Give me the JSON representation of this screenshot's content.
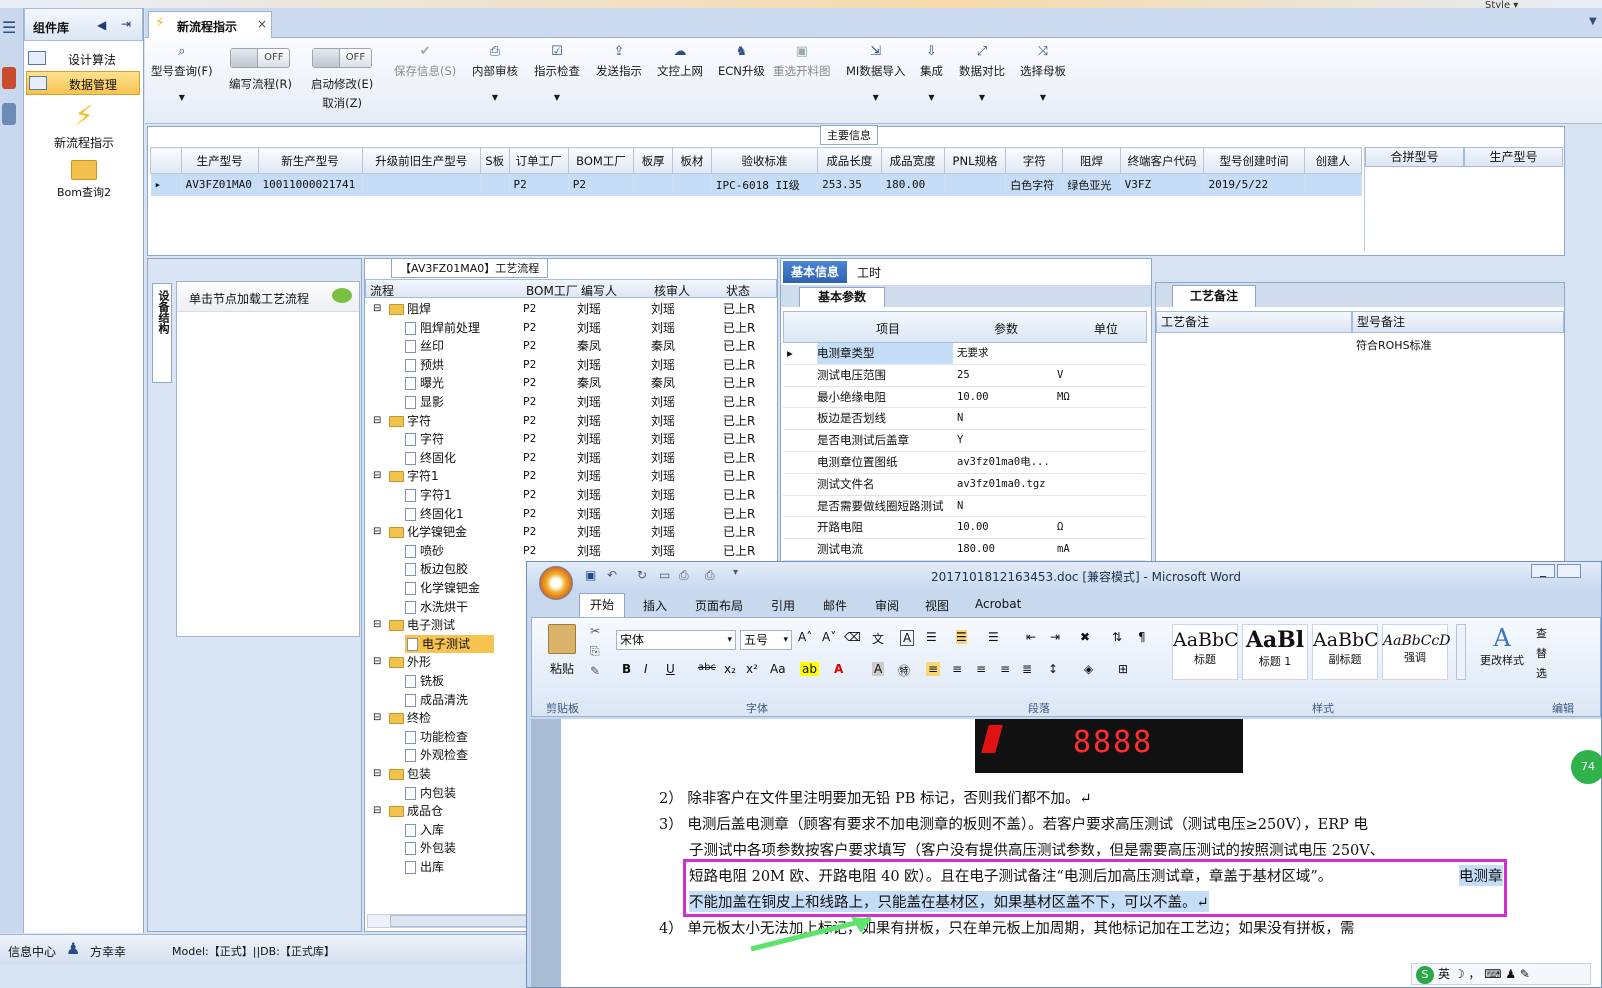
{
  "app": {
    "style_label": "Style",
    "components_label": "组件库"
  },
  "left_nav": {
    "items": [
      "设计算法",
      "数据管理"
    ],
    "big_items": [
      "新流程指示",
      "Bom查询2"
    ]
  },
  "tab": {
    "title": "新流程指示",
    "close": "×"
  },
  "toolbar": {
    "query": "型号查询(F)",
    "edit_toggle": "OFF",
    "edit_label": "编写流程(R)",
    "start_toggle": "OFF",
    "start_label": "启动修改(E)",
    "cancel_label": "取消(Z)",
    "buttons": [
      "保存信息(S)",
      "内部审核",
      "指示检查",
      "发送指示",
      "文控上网",
      "ECN升级",
      "重选开料图",
      "MI数据导入",
      "集成",
      "数据对比",
      "选择母板"
    ]
  },
  "main_info": {
    "title": "主要信息",
    "columns": [
      "生产型号",
      "新生产型号",
      "升级前旧生产型号",
      "S板",
      "订单工厂",
      "BOM工厂",
      "板厚",
      "板材",
      "验收标准",
      "成品长度",
      "成品宽度",
      "PNL规格",
      "字符",
      "阻焊",
      "终端客户代码",
      "型号创建时间",
      "创建人"
    ],
    "row": [
      "AV3FZ01MA0",
      "10011000021741",
      "",
      "",
      "P2",
      "P2",
      "",
      "",
      "IPC-6018 II级",
      "253.35",
      "180.00",
      "",
      "白色字符",
      "绿色亚光",
      "V3FZ",
      "2019/5/22",
      ""
    ],
    "side_columns": [
      "合拼型号",
      "生产型号"
    ]
  },
  "device_panel": {
    "tab": "设备结构",
    "hint": "单击节点加载工艺流程"
  },
  "flow": {
    "title": "【AV3FZ01MA0】工艺流程",
    "columns": [
      "流程",
      "BOM工厂",
      "编写人",
      "核审人",
      "状态"
    ],
    "rows": [
      {
        "level": 0,
        "name": "阻焊",
        "bom": "P2",
        "writer": "刘瑶",
        "checker": "刘瑶",
        "status": "已上R"
      },
      {
        "level": 1,
        "name": "阻焊前处理",
        "bom": "P2",
        "writer": "刘瑶",
        "checker": "刘瑶",
        "status": "已上R"
      },
      {
        "level": 1,
        "name": "丝印",
        "bom": "P2",
        "writer": "秦凤",
        "checker": "秦凤",
        "status": "已上R"
      },
      {
        "level": 1,
        "name": "预烘",
        "bom": "P2",
        "writer": "刘瑶",
        "checker": "刘瑶",
        "status": "已上R"
      },
      {
        "level": 1,
        "name": "曝光",
        "bom": "P2",
        "writer": "秦凤",
        "checker": "秦凤",
        "status": "已上R"
      },
      {
        "level": 1,
        "name": "显影",
        "bom": "P2",
        "writer": "刘瑶",
        "checker": "刘瑶",
        "status": "已上R"
      },
      {
        "level": 0,
        "name": "字符",
        "bom": "P2",
        "writer": "刘瑶",
        "checker": "刘瑶",
        "status": "已上R"
      },
      {
        "level": 1,
        "name": "字符",
        "bom": "P2",
        "writer": "刘瑶",
        "checker": "刘瑶",
        "status": "已上R"
      },
      {
        "level": 1,
        "name": "终固化",
        "bom": "P2",
        "writer": "刘瑶",
        "checker": "刘瑶",
        "status": "已上R"
      },
      {
        "level": 0,
        "name": "字符1",
        "bom": "P2",
        "writer": "刘瑶",
        "checker": "刘瑶",
        "status": "已上R"
      },
      {
        "level": 1,
        "name": "字符1",
        "bom": "P2",
        "writer": "刘瑶",
        "checker": "刘瑶",
        "status": "已上R"
      },
      {
        "level": 1,
        "name": "终固化1",
        "bom": "P2",
        "writer": "刘瑶",
        "checker": "刘瑶",
        "status": "已上R"
      },
      {
        "level": 0,
        "name": "化学镍钯金",
        "bom": "P2",
        "writer": "刘瑶",
        "checker": "刘瑶",
        "status": "已上R"
      },
      {
        "level": 1,
        "name": "喷砂",
        "bom": "P2",
        "writer": "刘瑶",
        "checker": "刘瑶",
        "status": "已上R"
      },
      {
        "level": 1,
        "name": "板边包胶",
        "bom": "",
        "writer": "",
        "checker": "",
        "status": ""
      },
      {
        "level": 1,
        "name": "化学镍钯金",
        "bom": "",
        "writer": "",
        "checker": "",
        "status": ""
      },
      {
        "level": 1,
        "name": "水洗烘干",
        "bom": "",
        "writer": "",
        "checker": "",
        "status": ""
      },
      {
        "level": 0,
        "name": "电子测试",
        "bom": "",
        "writer": "",
        "checker": "",
        "status": ""
      },
      {
        "level": 1,
        "name": "电子测试",
        "bom": "",
        "writer": "",
        "checker": "",
        "status": "",
        "selected": true
      },
      {
        "level": 0,
        "name": "外形",
        "bom": "",
        "writer": "",
        "checker": "",
        "status": ""
      },
      {
        "level": 1,
        "name": "铣板",
        "bom": "",
        "writer": "",
        "checker": "",
        "status": ""
      },
      {
        "level": 1,
        "name": "成品清洗",
        "bom": "",
        "writer": "",
        "checker": "",
        "status": ""
      },
      {
        "level": 0,
        "name": "终检",
        "bom": "",
        "writer": "",
        "checker": "",
        "status": ""
      },
      {
        "level": 1,
        "name": "功能检查",
        "bom": "",
        "writer": "",
        "checker": "",
        "status": ""
      },
      {
        "level": 1,
        "name": "外观检查",
        "bom": "",
        "writer": "",
        "checker": "",
        "status": ""
      },
      {
        "level": 0,
        "name": "包装",
        "bom": "",
        "writer": "",
        "checker": "",
        "status": ""
      },
      {
        "level": 1,
        "name": "内包装",
        "bom": "",
        "writer": "",
        "checker": "",
        "status": ""
      },
      {
        "level": 0,
        "name": "成品仓",
        "bom": "",
        "writer": "",
        "checker": "",
        "status": ""
      },
      {
        "level": 1,
        "name": "入库",
        "bom": "",
        "writer": "",
        "checker": "",
        "status": ""
      },
      {
        "level": 1,
        "name": "外包装",
        "bom": "",
        "writer": "",
        "checker": "",
        "status": ""
      },
      {
        "level": 1,
        "name": "出库",
        "bom": "",
        "writer": "",
        "checker": "",
        "status": ""
      }
    ]
  },
  "basic": {
    "tabs": [
      "基本信息",
      "工时"
    ],
    "sub_tab": "基本参数",
    "columns": [
      "项目",
      "参数",
      "单位"
    ],
    "rows": [
      [
        "电测章类型",
        "无要求",
        ""
      ],
      [
        "测试电压范围",
        "25",
        "V"
      ],
      [
        "最小绝缘电阻",
        "10.00",
        "MΩ"
      ],
      [
        "板边是否划线",
        "N",
        ""
      ],
      [
        "是否电测试后盖章",
        "Y",
        ""
      ],
      [
        "电测章位置图纸",
        "av3fz01ma0电...",
        ""
      ],
      [
        "测试文件名",
        "av3fz01ma0.tgz",
        ""
      ],
      [
        "是否需要做线圈短路测试",
        "N",
        ""
      ],
      [
        "开路电阻",
        "10.00",
        "Ω"
      ],
      [
        "测试电流",
        "180.00",
        "mA"
      ]
    ]
  },
  "process_note": {
    "tab": "工艺备注",
    "columns": [
      "工艺备注",
      "型号备注"
    ],
    "model_note": "符合ROHS标准"
  },
  "status_bar": {
    "center": "信息中心",
    "user": "方幸幸",
    "model": "Model:【正式】||DB:【正式库】"
  },
  "word": {
    "title": "2017101812163453.doc [兼容模式] - Microsoft Word",
    "tabs": [
      "开始",
      "插入",
      "页面布局",
      "引用",
      "邮件",
      "审阅",
      "视图",
      "Acrobat"
    ],
    "font": "宋体",
    "size": "五号",
    "paste": "粘贴",
    "groups": [
      "剪贴板",
      "字体",
      "段落",
      "样式",
      "编辑"
    ],
    "styles": [
      {
        "sample": "AaBbC",
        "label": "标题"
      },
      {
        "sample": "AaBl",
        "label": "标题 1"
      },
      {
        "sample": "AaBbC",
        "label": "副标题"
      },
      {
        "sample": "AaBbCcD",
        "label": "强调"
      }
    ],
    "change_style": "更改样式",
    "edit_items": [
      "查",
      "替",
      "选"
    ],
    "stamp": "8888",
    "lines": [
      "2） 除非客户在文件里注明要加无铅 PB 标记，否则我们都不加。↵",
      "3） 电测后盖电测章（顾客有要求不加电测章的板则不盖）。若客户要求高压测试（测试电压≥250V），ERP 电",
      "子测试中各项参数按客户要求填写（客户没有提供高压测试参数，但是需要高压测试的按照测试电压 250V、",
      "短路电阻 20M 欧、开路电阻 40 欧）。且在电子测试备注“电测后加高压测试章，章盖于基材区域”。",
      "电测章",
      "不能加盖在铜皮上和线路上，只能盖在基材区，如果基材区盖不下，可以不盖。↵",
      "4） 单元板太小无法加上标记，如果有拼板，只在单元板上加周期，其他标记加在工艺边；如果没有拼板，需"
    ],
    "ime": "英",
    "circle": "74"
  },
  "colors": {
    "accent": "#3b73c4",
    "highlight_box": "#d12fd1",
    "arrow": "#5be36a",
    "selection": "#c5ddf6"
  }
}
